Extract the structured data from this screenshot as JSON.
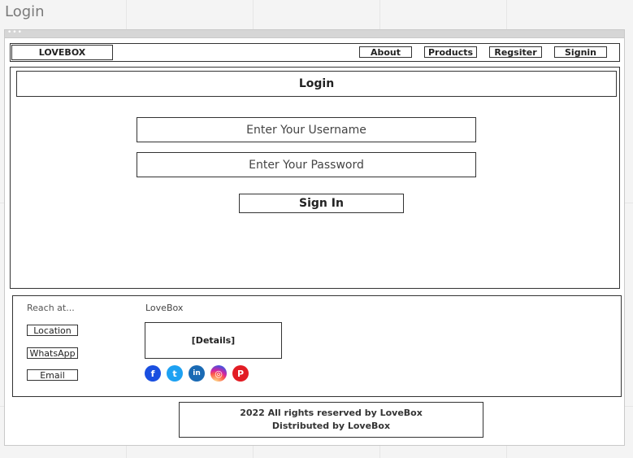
{
  "page": {
    "title": "Login"
  },
  "navbar": {
    "brand": "LOVEBOX",
    "links": [
      "About",
      "Products",
      "Regsiter",
      "Signin"
    ]
  },
  "login": {
    "title": "Login",
    "username_placeholder": "Enter Your Username",
    "password_placeholder": "Enter Your Password",
    "submit_label": "Sign In"
  },
  "footer": {
    "reach_label": "Reach at...",
    "brand": "LoveBox",
    "buttons": [
      "Location",
      "WhatsApp",
      "Email"
    ],
    "details": "[Details]",
    "social_icons": [
      {
        "name": "facebook-icon",
        "glyph": "f",
        "color": "#1a4fe0"
      },
      {
        "name": "twitter-icon",
        "glyph": "t",
        "color": "#1da1f2"
      },
      {
        "name": "linkedin-icon",
        "glyph": "in",
        "color": "#1a6ab4"
      },
      {
        "name": "instagram-icon",
        "glyph": "◎",
        "color": "#d6249f"
      },
      {
        "name": "pinterest-icon",
        "glyph": "P",
        "color": "#e21c24"
      }
    ],
    "copyright_line1": "2022 All rights reserved by LoveBox",
    "copyright_line2": "Distributed by LoveBox"
  }
}
